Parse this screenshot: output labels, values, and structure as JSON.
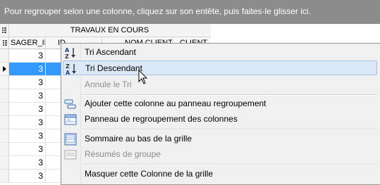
{
  "group_panel": {
    "hint": "Pour regrouper selon une colonne, cliquez sur son entête, puis faites-le glisser ici."
  },
  "grid": {
    "band_title": "TRAVAUX EN COURS",
    "columns": [
      "SAGER_II",
      "ID",
      "NOM CLIENT",
      "CLIENT"
    ],
    "rows": [
      "3",
      "3",
      "3",
      "3",
      "3",
      "3",
      "3",
      "3",
      "3",
      "3"
    ],
    "selected_row_index": 1
  },
  "context_menu": {
    "items": [
      {
        "label": "Tri Ascendant",
        "icon": "sort-ascending-icon",
        "disabled": false,
        "hover": false
      },
      {
        "label": "Tri Descendant",
        "icon": "sort-descending-icon",
        "disabled": false,
        "hover": true
      },
      {
        "label": "Annule le Tri",
        "icon": "",
        "disabled": true,
        "hover": false
      },
      {
        "label": "Ajouter cette colonne au panneau regroupement",
        "icon": "add-to-group-icon",
        "disabled": false,
        "hover": false
      },
      {
        "label": "Panneau de regroupement des colonnes",
        "icon": "group-panel-icon",
        "disabled": false,
        "hover": false
      },
      {
        "label": "Sommaire au bas de la grille",
        "icon": "footer-summary-icon",
        "disabled": false,
        "hover": false
      },
      {
        "label": "Résumés de groupe",
        "icon": "group-summary-icon",
        "disabled": true,
        "hover": false
      },
      {
        "label": "Masquer cette Colonne de la grille",
        "icon": "",
        "disabled": false,
        "hover": false
      }
    ]
  },
  "colors": {
    "group_panel_bg": "#8c8c8c",
    "selection": "#3399ff",
    "menu_hover": "#dbe8f7"
  }
}
